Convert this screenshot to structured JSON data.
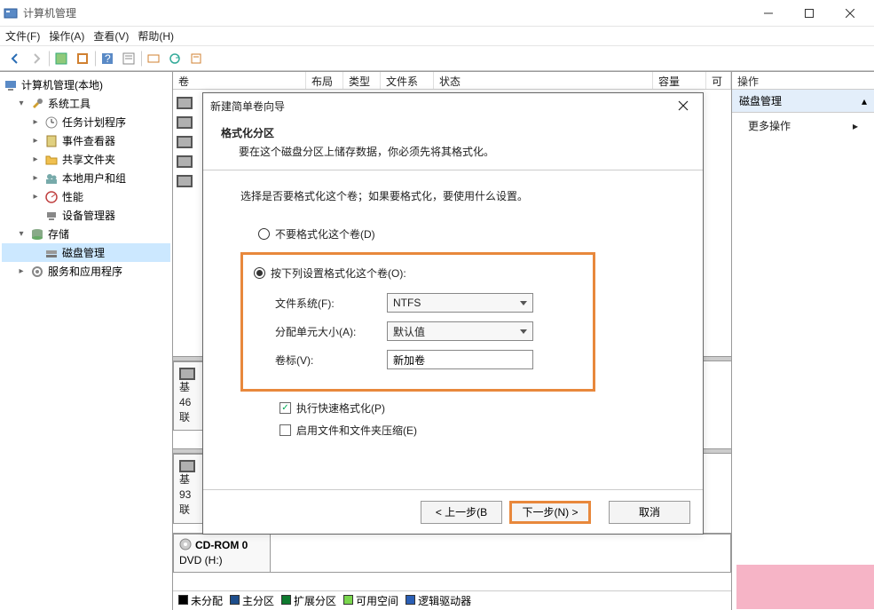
{
  "titlebar": {
    "title": "计算机管理"
  },
  "menubar": {
    "file": "文件(F)",
    "action": "操作(A)",
    "view": "查看(V)",
    "help": "帮助(H)"
  },
  "tree": {
    "root": "计算机管理(本地)",
    "sys_tools": "系统工具",
    "task_scheduler": "任务计划程序",
    "event_viewer": "事件查看器",
    "shared_folders": "共享文件夹",
    "local_users": "本地用户和组",
    "performance": "性能",
    "device_manager": "设备管理器",
    "storage": "存储",
    "disk_management": "磁盘管理",
    "services_apps": "服务和应用程序"
  },
  "list_header": {
    "volume": "卷",
    "layout": "布局",
    "type": "类型",
    "fs": "文件系统",
    "status": "状态",
    "capacity": "容量",
    "free": "可"
  },
  "disk_stubs": {
    "a_name": "基",
    "a_size": "46",
    "a_status": "联",
    "b_name": "基",
    "b_size": "93",
    "b_status": "联",
    "cd_label": "CD-ROM 0",
    "cd_drive": "DVD (H:)"
  },
  "legend": {
    "unallocated": "未分配",
    "primary": "主分区",
    "extended": "扩展分区",
    "free": "可用空间",
    "logical": "逻辑驱动器"
  },
  "legend_colors": {
    "unallocated": "#000000",
    "primary": "#1e4e8c",
    "extended": "#0f7a2f",
    "free": "#7ad64e",
    "logical": "#2b5fb5"
  },
  "actions": {
    "header": "操作",
    "disk_mgmt": "磁盘管理",
    "more": "更多操作"
  },
  "wizard": {
    "title": "新建简单卷向导",
    "section_title": "格式化分区",
    "section_desc": "要在这个磁盘分区上储存数据，你必须先将其格式化。",
    "body_desc": "选择是否要格式化这个卷；如果要格式化，要使用什么设置。",
    "radio_no_format": "不要格式化这个卷(D)",
    "radio_format": "按下列设置格式化这个卷(O):",
    "fs_label": "文件系统(F):",
    "fs_value": "NTFS",
    "alloc_label": "分配单元大小(A):",
    "alloc_value": "默认值",
    "vol_label": "卷标(V):",
    "vol_value": "新加卷",
    "chk_quick": "执行快速格式化(P)",
    "chk_compress": "启用文件和文件夹压缩(E)",
    "btn_back": "< 上一步(B",
    "btn_next": "下一步(N) >",
    "btn_cancel": "取消"
  }
}
